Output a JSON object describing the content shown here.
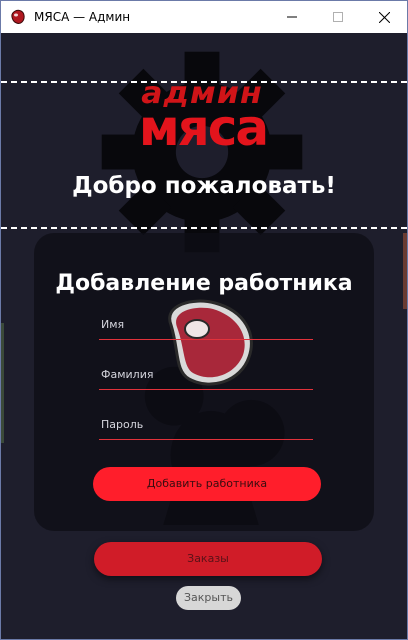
{
  "window": {
    "title": "МЯСА — Админ"
  },
  "logo": {
    "top_text": "админ",
    "main_text": "мяса"
  },
  "welcome_text": "Добро пожаловать!",
  "form": {
    "title": "Добавление работника",
    "fields": [
      {
        "label": "Имя"
      },
      {
        "label": "Фамилия"
      },
      {
        "label": "Пароль"
      }
    ],
    "submit_label": "Добавить работника"
  },
  "buttons": {
    "orders_label": "Заказы",
    "close_label": "Закрыть"
  },
  "colors": {
    "accent": "#ff1e2b",
    "background": "#1e1e2c",
    "field_underline": "#e2323b"
  },
  "icons": [
    "app-steak-icon",
    "minimize-icon",
    "maximize-icon",
    "close-icon",
    "gear-icon",
    "steak-icon"
  ]
}
